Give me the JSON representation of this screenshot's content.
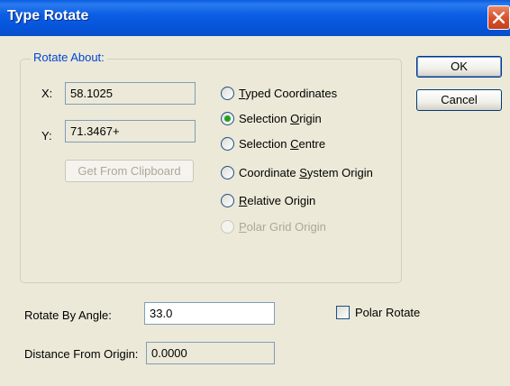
{
  "window": {
    "title": "Type Rotate"
  },
  "rotate_about": {
    "group_label": "Rotate About:",
    "x_label": "X:",
    "x_value": "58.1025",
    "y_label": "Y:",
    "y_value": "71.3467+",
    "clipboard_button": "Get From Clipboard",
    "options": [
      {
        "pre": "",
        "key": "T",
        "post": "yped Coordinates",
        "checked": false,
        "enabled": true
      },
      {
        "pre": "Selection ",
        "key": "O",
        "post": "rigin",
        "checked": true,
        "enabled": true
      },
      {
        "pre": "Selection ",
        "key": "C",
        "post": "entre",
        "checked": false,
        "enabled": true
      },
      {
        "pre": "Coordinate ",
        "key": "S",
        "post": "ystem Origin",
        "checked": false,
        "enabled": true
      },
      {
        "pre": "",
        "key": "R",
        "post": "elative Origin",
        "checked": false,
        "enabled": true
      },
      {
        "pre": "",
        "key": "P",
        "post": "olar Grid Origin",
        "checked": false,
        "enabled": false
      }
    ]
  },
  "buttons": {
    "ok": "OK",
    "cancel": "Cancel"
  },
  "angle": {
    "label": "Rotate By Angle:",
    "value": "33.0"
  },
  "polar_rotate": {
    "label": "Polar Rotate",
    "checked": false
  },
  "distance": {
    "label": "Distance From Origin:",
    "value": "0.0000"
  }
}
